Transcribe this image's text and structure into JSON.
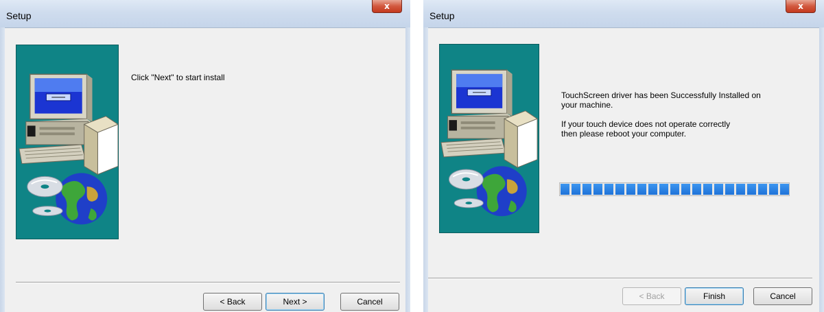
{
  "dialogs": [
    {
      "title": "Setup",
      "close_label": "x",
      "message": "Click \"Next\" to start install",
      "buttons": {
        "back": "< Back",
        "next": "Next >",
        "cancel": "Cancel"
      }
    },
    {
      "title": "Setup",
      "close_label": "x",
      "message_line1": "TouchScreen driver has been Successfully Installed on",
      "message_line2": "your machine.",
      "message_line3": "If your touch device does not operate correctly",
      "message_line4": "then please reboot your computer.",
      "progress_percent": 100,
      "buttons": {
        "back": "< Back",
        "finish": "Finish",
        "cancel": "Cancel"
      }
    }
  ],
  "colors": {
    "side_panel": "#0f8486",
    "progress": "#2a86e8",
    "close": "#c4391e"
  }
}
